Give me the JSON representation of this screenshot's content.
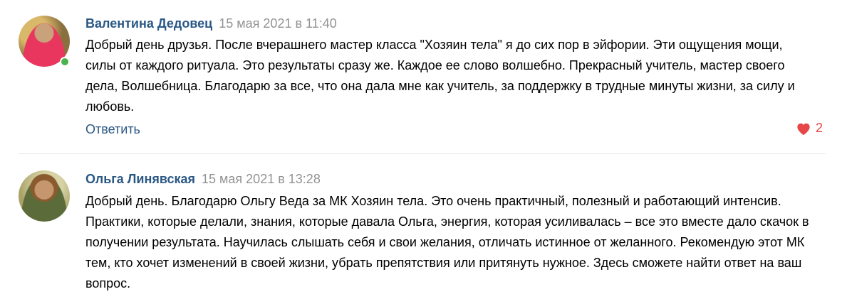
{
  "comments": [
    {
      "author": "Валентина Дедовец",
      "date": "15 мая 2021 в 11:40",
      "text": "Добрый день друзья. После вчерашнего мастер класса \"Хозяин тела\" я до сих пор в эйфории. Эти ощущения мощи, силы от каждого ритуала. Это результаты сразу же. Каждое ее слово волшебно. Прекрасный учитель, мастер своего дела, Волшебница. Благодарю за все, что она дала мне как учитель, за поддержку в трудные минуты жизни, за силу и любовь.",
      "reply_label": "Ответить",
      "likes": "2",
      "online": true
    },
    {
      "author": "Ольга Линявская",
      "date": "15 мая 2021 в 13:28",
      "text": "Добрый день. Благодарю Ольгу Веда за МК Хозяин тела. Это очень практичный, полезный и работающий интенсив. Практики, которые делали, знания, которые давала Ольга, энергия, которая усиливалась – все это вместе дало скачок в получении результата. Научилась слышать себя и свои желания, отличать истинное от желанного. Рекомендую этот МК тем, кто хочет изменений в своей жизни, убрать препятствия или притянуть нужное. Здесь сможете найти ответ на ваш вопрос."
    }
  ],
  "colors": {
    "author": "#2a5885",
    "date": "#939393",
    "like": "#e64646",
    "online": "#4bb34b"
  },
  "icons": {
    "like": "heart-icon"
  }
}
